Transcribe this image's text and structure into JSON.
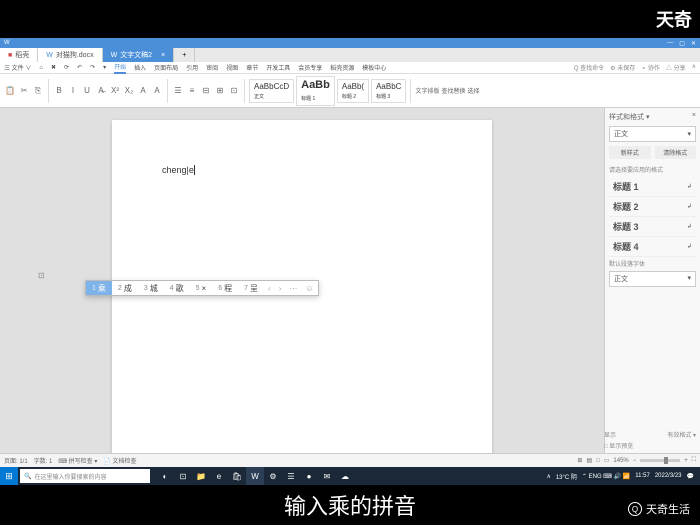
{
  "letterbox": {
    "logo_tr": "天奇",
    "subtitle": "输入乘的拼音",
    "brand": "天奇生活",
    "brand_icon": "Q"
  },
  "tabs": [
    {
      "icon": "■",
      "label": "稻壳"
    },
    {
      "icon": "W",
      "label": "对猫狗.docx"
    },
    {
      "icon": "W",
      "label": "文字文稿2"
    }
  ],
  "menu": {
    "items": [
      "三 文件 ∨",
      "⌂",
      "✖",
      "⟳",
      "↶",
      "↷",
      "▾",
      "开始",
      "插入",
      "页面布局",
      "引用",
      "审阅",
      "视图",
      "章节",
      "开发工具",
      "会员专享",
      "稻壳资源",
      "模板中心"
    ],
    "right": [
      "Q 查找命令",
      "⚙ 未保存",
      "⚬ 协作",
      "△ 分享",
      "∧"
    ]
  },
  "ribbon": {
    "buttons": [
      "✂",
      "⎘",
      "B",
      "I",
      "U",
      "A̶",
      "X²",
      "X₂",
      "A",
      "A",
      "A",
      "☰",
      "≡",
      "⊟",
      "⊞",
      "⊡",
      "三",
      "AaBbCcD",
      "AaBb",
      "AaBb(",
      "AaBbC",
      "文字排版",
      "查找替换",
      "选择"
    ],
    "style_labels": [
      "正文",
      "标题 1",
      "标题 2",
      "标题 3"
    ]
  },
  "document": {
    "typed": "chen",
    "cursor_char": "g|e"
  },
  "ime": {
    "candidates": [
      {
        "n": "1",
        "c": "乘"
      },
      {
        "n": "2",
        "c": "成"
      },
      {
        "n": "3",
        "c": "城"
      },
      {
        "n": "4",
        "c": "歌"
      },
      {
        "n": "5",
        "c": "×"
      },
      {
        "n": "6",
        "c": "程"
      },
      {
        "n": "7",
        "c": "呈"
      }
    ],
    "nav": [
      "‹",
      "›",
      "⋯",
      "☺"
    ]
  },
  "side": {
    "title": "样式和格式 ▾",
    "current": "正文",
    "btns": [
      "新样式",
      "清除格式"
    ],
    "sub": "请选择要应用的格式",
    "styles": [
      "标题 1",
      "标题 2",
      "标题 3",
      "标题 4"
    ],
    "preset_label": "默认段落字体",
    "preset_val": "正文",
    "bottom": [
      [
        "显示",
        "有效格式 ▾"
      ],
      [
        "□ 显示预览",
        ""
      ]
    ]
  },
  "status": {
    "left": [
      "页面: 1/1",
      "字数: 1",
      "⌨ 拼写检查 ▾",
      "📄 文档检查"
    ],
    "right": [
      "⊞",
      "▤",
      "□",
      "▭",
      "145%",
      "−",
      "+",
      "⛶"
    ]
  },
  "taskbar": {
    "search_placeholder": "在这里输入你要搜索的内容",
    "icons": [
      "◐",
      "⊡",
      "📁",
      "e",
      "🛍",
      "W",
      "⚙",
      "☰",
      "●",
      "✉",
      "☁"
    ],
    "right": [
      "∧",
      "13°C 阴",
      "⌃ ENG ⌨ 🔊 📶",
      "11:57",
      "2022/3/23",
      "💬"
    ]
  }
}
